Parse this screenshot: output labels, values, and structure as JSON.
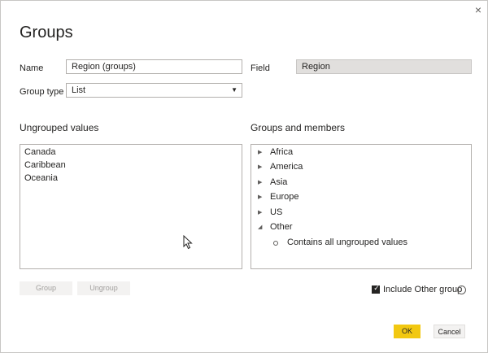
{
  "dialog": {
    "title": "Groups",
    "close_glyph": "×"
  },
  "form": {
    "name_label": "Name",
    "name_value": "Region (groups)",
    "field_label": "Field",
    "field_value": "Region",
    "group_type_label": "Group type",
    "group_type_value": "List"
  },
  "ungrouped": {
    "title": "Ungrouped values",
    "items": [
      "Canada",
      "Caribbean",
      "Oceania"
    ]
  },
  "groups": {
    "title": "Groups and members",
    "items": [
      {
        "label": "Africa",
        "expanded": false
      },
      {
        "label": "America",
        "expanded": false
      },
      {
        "label": "Asia",
        "expanded": false
      },
      {
        "label": "Europe",
        "expanded": false
      },
      {
        "label": "US",
        "expanded": false
      },
      {
        "label": "Other",
        "expanded": true
      }
    ],
    "other_member": "Contains all ungrouped values"
  },
  "buttons": {
    "group": "Group",
    "ungroup": "Ungroup",
    "ok": "OK",
    "cancel": "Cancel"
  },
  "include_other": {
    "label": "Include Other group",
    "checked": true
  },
  "colors": {
    "accent": "#f2c811",
    "disabled_bg": "#f3f2f1"
  }
}
